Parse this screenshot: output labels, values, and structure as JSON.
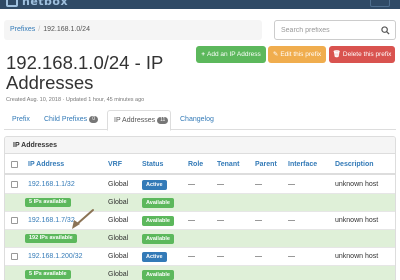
{
  "navbar": {
    "brand": "netbox"
  },
  "breadcrumb": {
    "root": "Prefixes",
    "separator": "/",
    "current": "192.168.1.0/24"
  },
  "search": {
    "placeholder": "Search prefixes"
  },
  "actions": {
    "add": {
      "icon": "+",
      "label": "Add an IP Address"
    },
    "edit": {
      "icon": "✎",
      "label": "Edit this prefix"
    },
    "delete": {
      "icon": "🗑",
      "label": "Delete this prefix"
    }
  },
  "page": {
    "title": "192.168.1.0/24 - IP Addresses",
    "meta": "Created Aug. 10, 2018 · Updated 1 hour, 45 minutes ago"
  },
  "tabs": [
    {
      "label": "Prefix"
    },
    {
      "label": "Child Prefixes",
      "badge": "0"
    },
    {
      "label": "IP Addresses",
      "badge": "11",
      "active": true
    },
    {
      "label": "Changelog"
    }
  ],
  "panel": {
    "heading": "IP Addresses"
  },
  "table": {
    "columns": [
      "IP Address",
      "VRF",
      "Status",
      "Role",
      "Tenant",
      "Parent",
      "Interface",
      "Description"
    ],
    "rows": [
      {
        "kind": "ip",
        "address": "192.168.1.1/32",
        "vrf": "Global",
        "status": "Active",
        "role": "—",
        "tenant": "—",
        "parent": "—",
        "interface": "—",
        "description": "unknown host"
      },
      {
        "kind": "avail",
        "label": "5 IPs available",
        "vrf": "Global",
        "status": "Available"
      },
      {
        "kind": "ip",
        "address": "192.168.1.7/32",
        "vrf": "Global",
        "status": "Available",
        "role": "—",
        "tenant": "—",
        "parent": "—",
        "interface": "—",
        "description": "unknown host"
      },
      {
        "kind": "avail",
        "label": "192 IPs available",
        "vrf": "Global",
        "status": "Available"
      },
      {
        "kind": "ip",
        "address": "192.168.1.200/32",
        "vrf": "Global",
        "status": "Active",
        "role": "—",
        "tenant": "—",
        "parent": "—",
        "interface": "—",
        "description": "unknown host"
      },
      {
        "kind": "avail",
        "label": "5 IPs available",
        "vrf": "Global",
        "status": "Available"
      }
    ]
  },
  "colors": {
    "navbar": "#2f4a66",
    "link": "#337ab7",
    "success": "#5cb85c",
    "warning": "#f0ad4e",
    "danger": "#d9534f",
    "available_row": "#dff0d8",
    "annotation_arrow": "#8b7355"
  }
}
